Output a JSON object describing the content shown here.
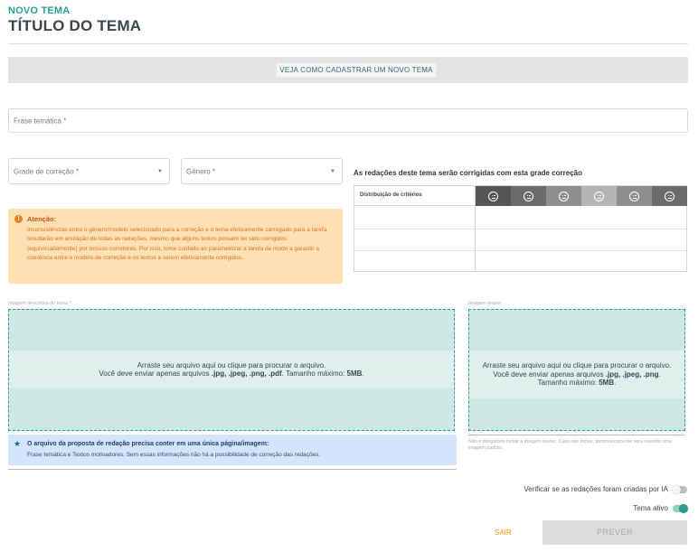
{
  "header": {
    "subtitle": "NOVO TEMA",
    "title": "TÍTULO DO TEMA"
  },
  "banner": {
    "button_label": "VEJA COMO CADASTRAR UM NOVO TEMA"
  },
  "form": {
    "frase_placeholder": "Frase temática *",
    "grade_placeholder": "Grade de correção *",
    "genero_placeholder": "Gênero *"
  },
  "warning": {
    "title": "Atenção:",
    "body": "Inconsistências entre o gênero/modelo selecionado para a correção e o tema efetivamente carregado para a tarefa resultarão em anulação de todas as redações, mesmo que alguns textos possam ter sido corrigidos (equivocadamente) por nossos corretores. Por isso, tome cuidado ao parametrizar a tarefa de modo a garantir a coerência entre o modelo de correção e os textos a serem efetivamente corrigidos."
  },
  "grid": {
    "title": "As redações deste tema serão corrigidas com esta grade correção",
    "column_label": "Distribuição de critérios",
    "face_colors": [
      "#555555",
      "#6b6b6b",
      "#8e8e8e",
      "#b4b4b4",
      "#8e8e8e",
      "#6b6b6b"
    ],
    "face_icons": [
      "very-sad-face-icon",
      "sad-face-icon",
      "neutral-face-icon",
      "neutral-face-icon",
      "happy-face-icon",
      "very-happy-face-icon"
    ]
  },
  "upload_main": {
    "label": "Imagem descritiva do tema *",
    "line1": "Arraste seu arquivo aqui ou clique para procurar o arquivo.",
    "line2_prefix": "Você deve enviar apenas arquivos",
    "line2_types": ".jpg, .jpeg, .png, .pdf",
    "line2_mid": ". Tamanho máximo:",
    "line2_size": "5MB",
    "line2_end": "."
  },
  "upload_teaser": {
    "label": "Imagem teaser",
    "line1": "Arraste seu arquivo aqui ou clique para procurar o arquivo.",
    "line2_prefix": "Você deve enviar apenas arquivos",
    "line2_types": ".jpg, .jpeg, .png",
    "line3_prefix": "Tamanho máximo:",
    "line3_size": "5MB",
    "note": "Não é obrigatório incluir a imagem teaser. Caso não inclua, automaticamente será inserida uma imagem padrão."
  },
  "info": {
    "title": "O arquivo da proposta de redação precisa conter em uma única página/imagem:",
    "body": "Frase temática e Textos motivadores. Sem essas informações não há a possibilidade de correção das redações."
  },
  "toggles": {
    "ia_label": "Verificar se as redações foram criadas por IA",
    "ia_on": false,
    "ativo_label": "Tema ativo",
    "ativo_on": true
  },
  "actions": {
    "sair_label": "SAIR",
    "prever_label": "PREVER"
  },
  "colors": {
    "accent": "#2a9d8f",
    "warning_bg": "#ffe0b2",
    "info_bg": "#d4e4fb",
    "sair": "#f39c12"
  }
}
